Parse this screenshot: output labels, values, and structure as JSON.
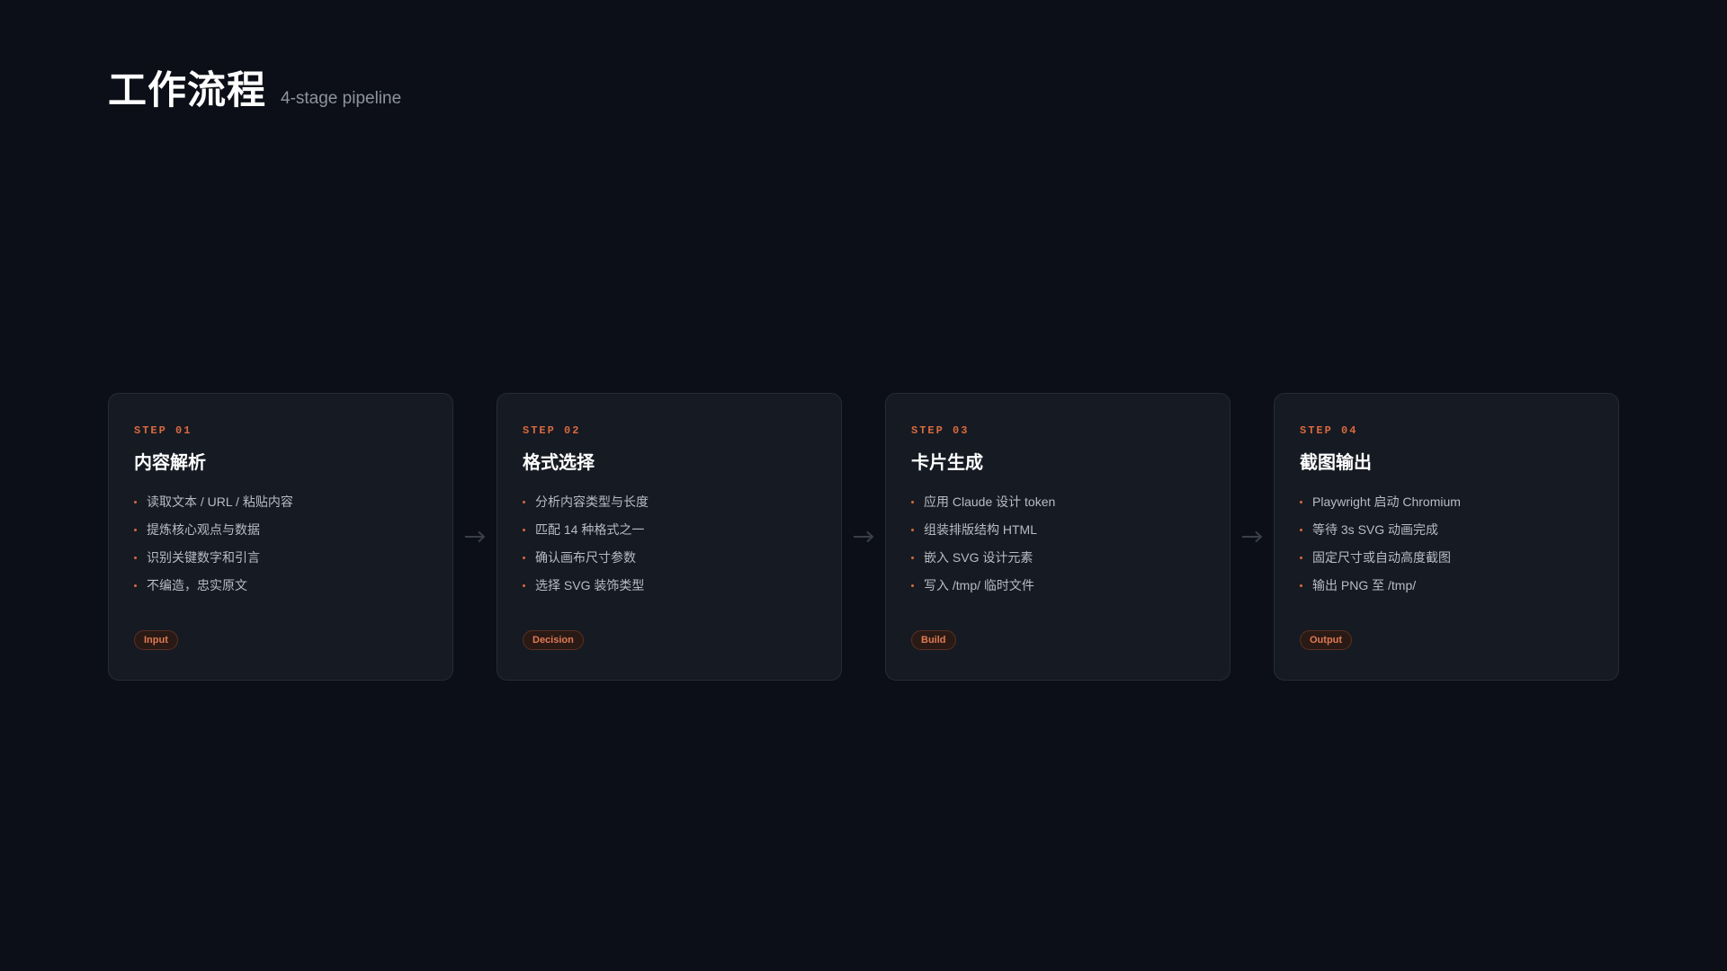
{
  "header": {
    "title": "工作流程",
    "subtitle": "4-stage pipeline"
  },
  "steps": [
    {
      "label": "STEP 01",
      "title": "内容解析",
      "items": [
        "读取文本 / URL / 粘贴内容",
        "提炼核心观点与数据",
        "识别关键数字和引言",
        "不编造，忠实原文"
      ],
      "tag": "Input"
    },
    {
      "label": "STEP 02",
      "title": "格式选择",
      "items": [
        "分析内容类型与长度",
        "匹配 14 种格式之一",
        "确认画布尺寸参数",
        "选择 SVG 装饰类型"
      ],
      "tag": "Decision"
    },
    {
      "label": "STEP 03",
      "title": "卡片生成",
      "items": [
        "应用 Claude 设计 token",
        "组装排版结构 HTML",
        "嵌入 SVG 设计元素",
        "写入 /tmp/ 临时文件"
      ],
      "tag": "Build"
    },
    {
      "label": "STEP 04",
      "title": "截图输出",
      "items": [
        "Playwright 启动 Chromium",
        "等待 3s SVG 动画完成",
        "固定尺寸或自动高度截图",
        "输出 PNG 至 /tmp/"
      ],
      "tag": "Output"
    }
  ],
  "colors": {
    "accent": "#d9693f",
    "background": "#0c0f17",
    "card": "#161a22"
  },
  "icons": {
    "connector": "arrow-right-icon",
    "bullet": "bullet-dot-icon"
  }
}
